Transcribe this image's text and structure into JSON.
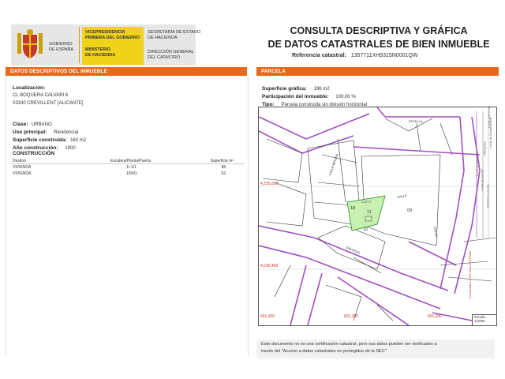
{
  "header": {
    "vicepresidencia": [
      "VICEPRESIDENCIA",
      "PRIMERA DEL GOBIERNO"
    ],
    "ministerio": [
      "MINISTERIO",
      "DE HACIENDA"
    ],
    "gobierno": [
      "GOBIERNO",
      "DE ESPAÑA"
    ],
    "secretaria": [
      "SECRETARÍA DE ESTADO",
      "DE HACIENDA"
    ],
    "direccion": [
      "DIRECCIÓN GENERAL",
      "DEL CATASTRO"
    ],
    "title_line1": "CONSULTA DESCRIPTIVA Y GRÁFICA",
    "title_line2": "DE DATOS CATASTRALES DE BIEN INMUEBLE",
    "ref_label": "Referencia catastral:",
    "ref_value": "1357711XH9315N0001QW"
  },
  "left": {
    "section_title": "DATOS DESCRIPTIVOS DEL INMUEBLE",
    "localizacion_label": "Localización:",
    "address1": "CL BOQUERA CALVARI 6",
    "address2": "03330 CREVILLENT [ALICANTE]",
    "clase_label": "Clase:",
    "clase_value": "URBANO",
    "uso_label": "Uso principal:",
    "uso_value": "Residencial",
    "sup_label": "Superficie construida:",
    "sup_value": "160 m2",
    "anio_label": "Año construcción:",
    "anio_value": "1900",
    "construccion_label": "CONSTRUCCIÓN",
    "table_headers": [
      "Destino",
      "Escalera/Planta/Puerta",
      "Superficie m²"
    ],
    "rows": [
      [
        "VIVIENDA",
        "1/-1/1",
        "98"
      ],
      [
        "VIVIENDA",
        "1/00/1",
        "62"
      ]
    ]
  },
  "right": {
    "section_title": "PARCELA",
    "sup_grafica_label": "Superficie gráfica:",
    "sup_grafica_value": "196 m2",
    "participacion_label": "Participación del inmueble:",
    "participacion_value": "100,00 %",
    "tipo_label": "Tipo:",
    "tipo_value": "Parcela construida sin división horizontal",
    "map": {
      "coord_top_left": "4,235,600",
      "coord_mid_left": "4,235,400",
      "bottom_coords": [
        "691,200",
        "691,300",
        "691,300"
      ],
      "parcel_numbers": [
        "18",
        "11",
        "09",
        "10",
        "13571"
      ],
      "street_labels": [
        "CALLE",
        "GALLEGO",
        "CALLE",
        "ESTELLA",
        "CALLE BRIONA"
      ],
      "legend": [
        "Límite de Manzana",
        "Límite de Parcela",
        "Límite de Construcciones",
        "Mobiliario y aceras",
        "Límite zona verde",
        "Hidrografía"
      ],
      "side_note": "Coordenadas U.T.M. Huso 30 ETRS89",
      "scale_label": "Escala:",
      "scale_value": "1/1000"
    },
    "footnote_line1": "Este documento no es una certificación catastral, pero sus datos pueden ser verificados a",
    "footnote_line2": "través del \"Acceso a datos catastrales no protegidos de la SEC\""
  },
  "colors": {
    "accent": "#e8691a",
    "parcel_fill": "#c8f0b0",
    "manzana_line": "#a050c0"
  }
}
